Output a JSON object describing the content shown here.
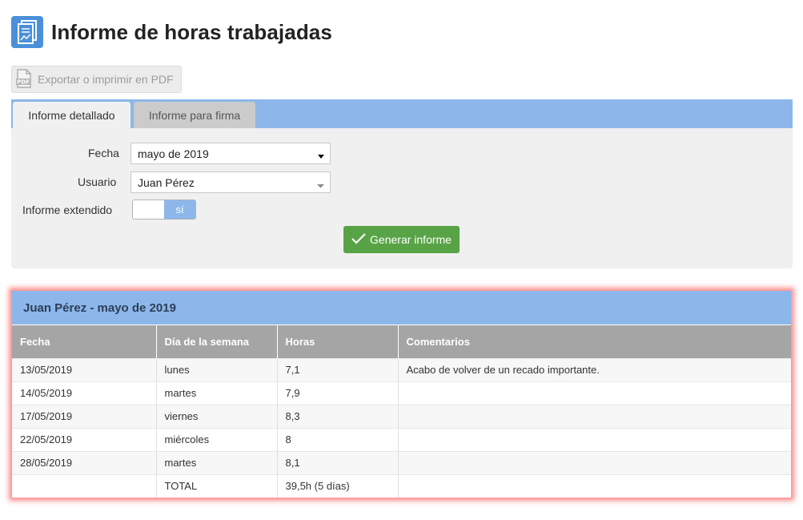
{
  "header": {
    "title": "Informe de horas trabajadas",
    "icon": "report-chart-icon"
  },
  "toolbar": {
    "pdf_label": "Exportar o imprimir en PDF",
    "pdf_icon_text": "PDF"
  },
  "tabs": [
    {
      "label": "Informe detallado",
      "active": true
    },
    {
      "label": "Informe para firma",
      "active": false
    }
  ],
  "form": {
    "fecha_label": "Fecha",
    "fecha_value": "mayo de 2019",
    "usuario_label": "Usuario",
    "usuario_value": "Juan Pérez",
    "extendido_label": "Informe extendido",
    "extendido_value": "sí",
    "generate_label": "Generar informe"
  },
  "report": {
    "title": "Juan Pérez - mayo de 2019",
    "columns": [
      "Fecha",
      "Día de la semana",
      "Horas",
      "Comentarios"
    ],
    "rows": [
      [
        "13/05/2019",
        "lunes",
        "7,1",
        "Acabo de volver de un recado importante."
      ],
      [
        "14/05/2019",
        "martes",
        "7,9",
        ""
      ],
      [
        "17/05/2019",
        "viernes",
        "8,3",
        ""
      ],
      [
        "22/05/2019",
        "miércoles",
        "8",
        ""
      ],
      [
        "28/05/2019",
        "martes",
        "8,1",
        ""
      ],
      [
        "",
        "TOTAL",
        "39,5h (5 días)",
        ""
      ]
    ]
  },
  "colors": {
    "accent": "#8db7ea",
    "success": "#58a346",
    "highlight": "#ff3232"
  }
}
